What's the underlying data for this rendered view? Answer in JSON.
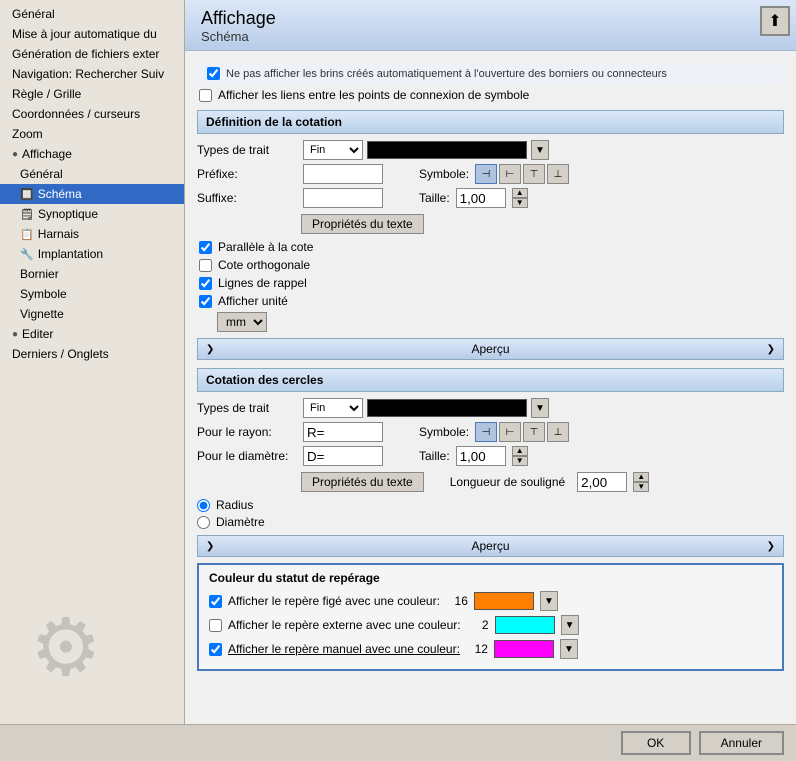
{
  "sidebar": {
    "items": [
      {
        "id": "general",
        "label": "Général",
        "indent": 0,
        "selected": false,
        "icon": ""
      },
      {
        "id": "maj-auto",
        "label": "Mise à jour automatique du",
        "indent": 0,
        "selected": false,
        "icon": ""
      },
      {
        "id": "gen-fichiers",
        "label": "Génération de fichiers exter",
        "indent": 0,
        "selected": false,
        "icon": ""
      },
      {
        "id": "navigation",
        "label": "Navigation: Rechercher Suiv",
        "indent": 0,
        "selected": false,
        "icon": ""
      },
      {
        "id": "regle",
        "label": "Règle / Grille",
        "indent": 0,
        "selected": false,
        "icon": ""
      },
      {
        "id": "coordonnees",
        "label": "Coordonnées / curseurs",
        "indent": 0,
        "selected": false,
        "icon": ""
      },
      {
        "id": "zoom",
        "label": "Zoom",
        "indent": 0,
        "selected": false,
        "icon": ""
      },
      {
        "id": "affichage",
        "label": "Affichage",
        "indent": 0,
        "selected": false,
        "icon": "circle"
      },
      {
        "id": "affichage-general",
        "label": "Général",
        "indent": 1,
        "selected": false,
        "icon": ""
      },
      {
        "id": "schema",
        "label": "Schéma",
        "indent": 1,
        "selected": true,
        "icon": "doc"
      },
      {
        "id": "synoptique",
        "label": "Synoptique",
        "indent": 1,
        "selected": false,
        "icon": "doc"
      },
      {
        "id": "harnais",
        "label": "Harnais",
        "indent": 1,
        "selected": false,
        "icon": "doc"
      },
      {
        "id": "implantation",
        "label": "Implantation",
        "indent": 1,
        "selected": false,
        "icon": "chip"
      },
      {
        "id": "bornier",
        "label": "Bornier",
        "indent": 1,
        "selected": false,
        "icon": ""
      },
      {
        "id": "symbole",
        "label": "Symbole",
        "indent": 1,
        "selected": false,
        "icon": ""
      },
      {
        "id": "vignette",
        "label": "Vignette",
        "indent": 1,
        "selected": false,
        "icon": ""
      },
      {
        "id": "editer",
        "label": "Editer",
        "indent": 0,
        "selected": false,
        "icon": "circle"
      },
      {
        "id": "derniers",
        "label": "Derniers / Onglets",
        "indent": 0,
        "selected": false,
        "icon": ""
      }
    ]
  },
  "header": {
    "title": "Affichage",
    "subtitle": "Schéma"
  },
  "notices": [
    "☑ Ne pas afficher les brins créés automatiquement à l'ouverture des borniers ou connecteurs",
    "☐ Afficher les liens entre les points de connexion de symbole"
  ],
  "sections": {
    "definition_cotation": {
      "title": "Définition de la cotation",
      "types_trait_label": "Types de trait",
      "types_trait_value": "Fin",
      "prefixe_label": "Préfixe:",
      "suffixe_label": "Suffixe:",
      "symbole_label": "Symbole:",
      "taille_label": "Taille:",
      "taille_value": "1,00",
      "props_btn": "Propriétés du texte",
      "apercu": "Aperçu",
      "checkboxes": [
        {
          "id": "parallele",
          "label": "Parallèle à la cote",
          "checked": true
        },
        {
          "id": "orthogonale",
          "label": "Cote orthogonale",
          "checked": false
        },
        {
          "id": "lignes_rappel",
          "label": "Lignes de rappel",
          "checked": true
        },
        {
          "id": "afficher_unite",
          "label": "Afficher unité",
          "checked": true
        }
      ],
      "mm_option": "mm"
    },
    "cotation_cercles": {
      "title": "Cotation des cercles",
      "types_trait_label": "Types de trait",
      "types_trait_value": "Fin",
      "rayon_label": "Pour le rayon:",
      "rayon_value": "R=",
      "diametre_label": "Pour le diamètre:",
      "diametre_value": "D=",
      "symbole_label": "Symbole:",
      "taille_label": "Taille:",
      "taille_value": "1,00",
      "longueur_label": "Longueur de souligné",
      "longueur_value": "2,00",
      "props_btn": "Propriétés du texte",
      "apercu": "Aperçu",
      "radios": [
        {
          "id": "radius",
          "label": "Radius",
          "checked": true
        },
        {
          "id": "diametre",
          "label": "Diamètre",
          "checked": false
        }
      ]
    },
    "couleur_statut": {
      "title": "Couleur du statut de repérage",
      "rows": [
        {
          "id": "repere_fige",
          "label": "Afficher le repère figé avec une couleur:",
          "checked": true,
          "num": "16",
          "color": "#ff8000"
        },
        {
          "id": "repere_externe",
          "label": "Afficher le repère externe avec une couleur:",
          "checked": false,
          "num": "2",
          "color": "#00ffff"
        },
        {
          "id": "repere_manuel",
          "label": "Afficher le repère manuel avec une couleur:",
          "checked": true,
          "num": "12",
          "color": "#ff00ff"
        }
      ]
    }
  },
  "bottom": {
    "ok_label": "OK",
    "annuler_label": "Annuler"
  },
  "upload_icon": "⬆"
}
